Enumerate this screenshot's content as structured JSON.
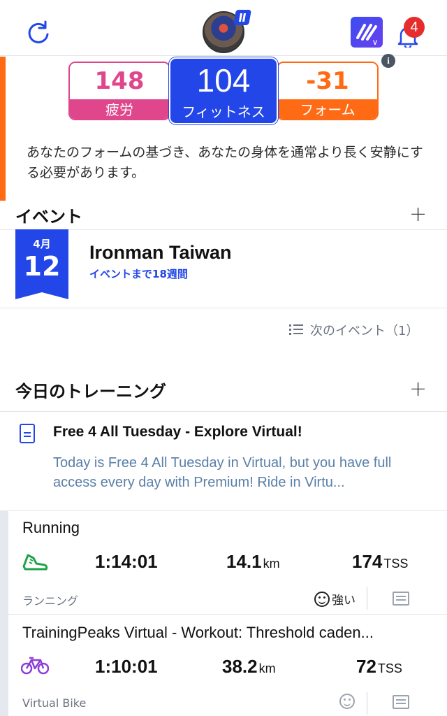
{
  "header": {
    "refresh_icon": "refresh-icon",
    "avatar_icon": "profile-avatar",
    "app_logo_icon": "trainingpeaks-virtual-logo",
    "notification_count": "4",
    "colors": {
      "accent": "#2346e8",
      "badge": "#e62d2d"
    }
  },
  "fitness": {
    "fatigue": {
      "value": "148",
      "label": "疲労",
      "color": "#e0468c"
    },
    "fitness": {
      "value": "104",
      "label": "フィットネス",
      "color": "#2346e8"
    },
    "form": {
      "value": "-31",
      "label": "フォーム",
      "color": "#ff6a14"
    },
    "info_icon": "i",
    "message": "あなたのフォームの基づき、あなたの身体を通常より長く安静にする必要があります。"
  },
  "events": {
    "title": "イベント",
    "add_label": "+",
    "event": {
      "month": "4月",
      "day": "12",
      "name": "Ironman Taiwan",
      "countdown": "イベントまで18週間"
    },
    "next_events_label": "次のイベント（1）"
  },
  "training": {
    "title": "今日のトレーニング",
    "add_label": "+",
    "note": {
      "title": "Free 4 All Tuesday - Explore Virtual!",
      "body": "Today is Free 4 All Tuesday in Virtual, but you have full access every day with Premium! Ride in Virtu..."
    },
    "workouts": [
      {
        "title": "Running",
        "sport_icon": "running-shoe-icon",
        "duration": "1:14:01",
        "distance": "14.1",
        "distance_unit": "km",
        "tss": "174",
        "tss_unit": "TSS",
        "type": "ランニング",
        "feel": "強い"
      },
      {
        "title": "TrainingPeaks Virtual - Workout: Threshold caden...",
        "sport_icon": "bike-icon",
        "duration": "1:10:01",
        "distance": "38.2",
        "distance_unit": "km",
        "tss": "72",
        "tss_unit": "TSS",
        "type": "Virtual Bike",
        "feel": ""
      }
    ]
  }
}
